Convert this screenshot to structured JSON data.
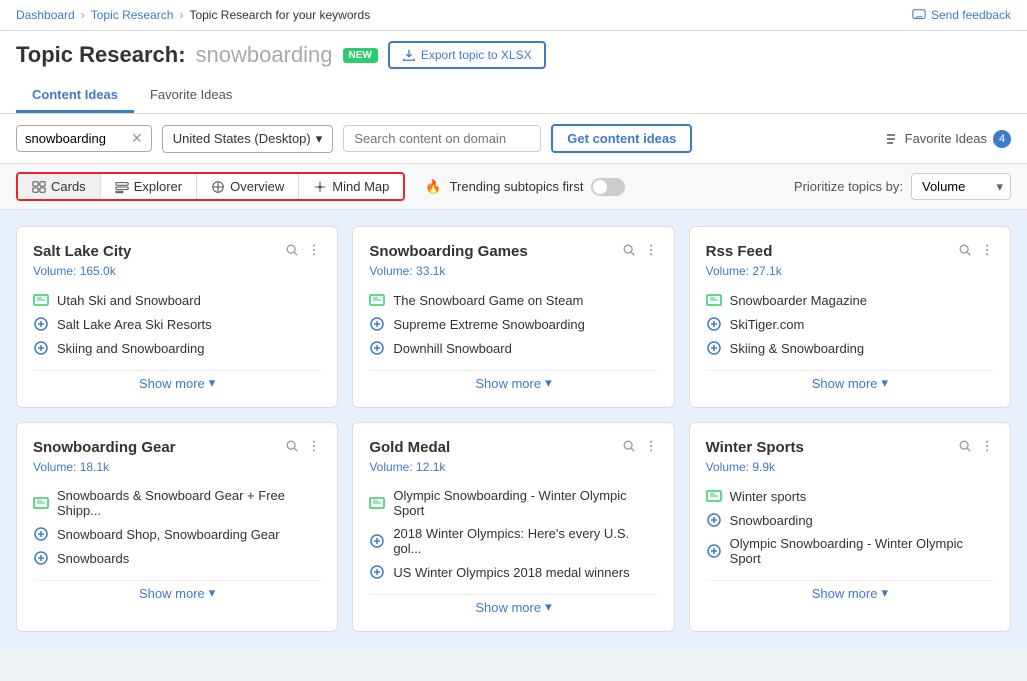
{
  "breadcrumb": {
    "items": [
      "Dashboard",
      "Topic Research",
      "Topic Research for your keywords"
    ]
  },
  "feedback": {
    "label": "Send feedback"
  },
  "header": {
    "title_prefix": "Topic Research:",
    "keyword": "snowboarding",
    "new_badge": "new",
    "export_btn": "Export topic to XLSX"
  },
  "tabs": [
    {
      "label": "Content Ideas",
      "active": true
    },
    {
      "label": "Favorite Ideas",
      "active": false
    }
  ],
  "toolbar": {
    "keyword_value": "snowboarding",
    "country": "United States (Desktop)",
    "domain_placeholder": "Search content on domain",
    "get_ideas_btn": "Get content ideas",
    "fav_label": "Favorite Ideas",
    "fav_count": "4"
  },
  "view": {
    "buttons": [
      {
        "label": "Cards",
        "active": true,
        "icon": "cards-icon"
      },
      {
        "label": "Explorer",
        "active": false,
        "icon": "explorer-icon"
      },
      {
        "label": "Overview",
        "active": false,
        "icon": "overview-icon"
      },
      {
        "label": "Mind Map",
        "active": false,
        "icon": "mindmap-icon"
      }
    ],
    "trending_label": "Trending subtopics first",
    "trending_on": false,
    "prioritize_label": "Prioritize topics by:",
    "volume_option": "Volume"
  },
  "cards": [
    {
      "title": "Salt Lake City",
      "volume": "Volume: 165.0k",
      "items": [
        {
          "text": "Utah Ski and Snowboard",
          "type": "green"
        },
        {
          "text": "Salt Lake Area Ski Resorts",
          "type": "blue"
        },
        {
          "text": "Skiing and Snowboarding",
          "type": "blue"
        }
      ],
      "show_more": "Show more"
    },
    {
      "title": "Snowboarding Games",
      "volume": "Volume: 33.1k",
      "items": [
        {
          "text": "The Snowboard Game on Steam",
          "type": "green"
        },
        {
          "text": "Supreme Extreme Snowboarding",
          "type": "blue"
        },
        {
          "text": "Downhill Snowboard",
          "type": "blue"
        }
      ],
      "show_more": "Show more"
    },
    {
      "title": "Rss Feed",
      "volume": "Volume: 27.1k",
      "items": [
        {
          "text": "Snowboarder Magazine",
          "type": "green"
        },
        {
          "text": "SkiTiger.com",
          "type": "blue"
        },
        {
          "text": "Skiing & Snowboarding",
          "type": "blue"
        }
      ],
      "show_more": "Show more"
    },
    {
      "title": "Snowboarding Gear",
      "volume": "Volume: 18.1k",
      "items": [
        {
          "text": "Snowboards & Snowboard Gear + Free Shipp...",
          "type": "green"
        },
        {
          "text": "Snowboard Shop, Snowboarding Gear",
          "type": "blue"
        },
        {
          "text": "Snowboards",
          "type": "blue"
        }
      ],
      "show_more": "Show more"
    },
    {
      "title": "Gold Medal",
      "volume": "Volume: 12.1k",
      "items": [
        {
          "text": "Olympic Snowboarding - Winter Olympic Sport",
          "type": "green"
        },
        {
          "text": "2018 Winter Olympics: Here's every U.S. gol...",
          "type": "blue"
        },
        {
          "text": "US Winter Olympics 2018 medal winners",
          "type": "blue"
        }
      ],
      "show_more": "Show more"
    },
    {
      "title": "Winter Sports",
      "volume": "Volume: 9.9k",
      "items": [
        {
          "text": "Winter sports",
          "type": "green"
        },
        {
          "text": "Snowboarding",
          "type": "blue"
        },
        {
          "text": "Olympic Snowboarding - Winter Olympic Sport",
          "type": "blue"
        }
      ],
      "show_more": "Show more"
    }
  ]
}
